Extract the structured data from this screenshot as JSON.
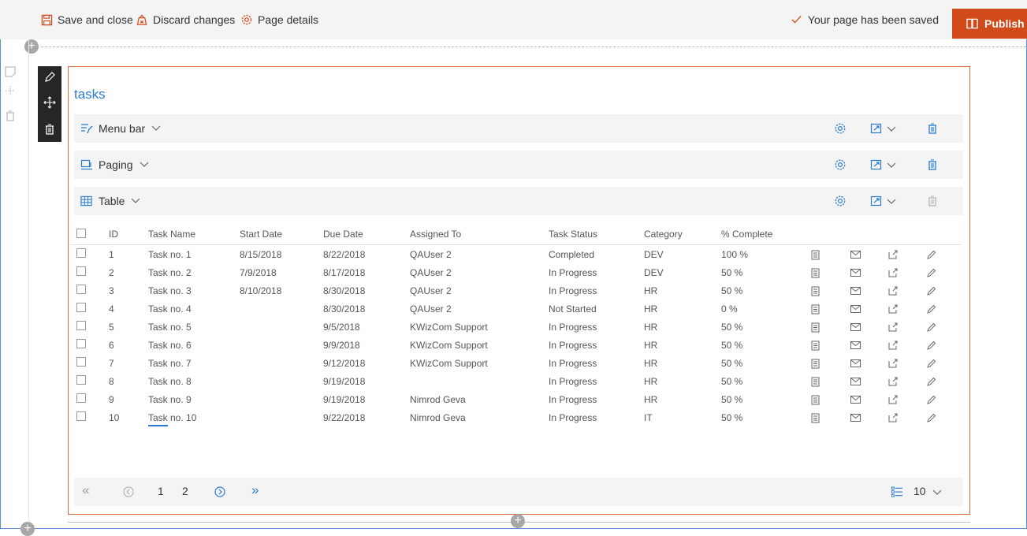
{
  "commandbar": {
    "save_close": "Save and close",
    "discard": "Discard changes",
    "details": "Page details",
    "saved_status": "Your page has been saved",
    "publish": "Publish"
  },
  "webpart": {
    "title": "tasks",
    "sections": [
      {
        "label": "Menu bar"
      },
      {
        "label": "Paging"
      },
      {
        "label": "Table"
      }
    ]
  },
  "table": {
    "headers": [
      "ID",
      "Task Name",
      "Start Date",
      "Due Date",
      "Assigned To",
      "Task Status",
      "Category",
      "% Complete"
    ],
    "rows": [
      [
        "1",
        "Task no. 1",
        "8/15/2018",
        "8/22/2018",
        "QAUser 2",
        "Completed",
        "DEV",
        "100 %"
      ],
      [
        "2",
        "Task no. 2",
        "7/9/2018",
        "8/17/2018",
        "QAUser 2",
        "In Progress",
        "DEV",
        "50 %"
      ],
      [
        "3",
        "Task no. 3",
        "8/10/2018",
        "8/30/2018",
        "QAUser 2",
        "In Progress",
        "HR",
        "50 %"
      ],
      [
        "4",
        "Task no. 4",
        "",
        "8/30/2018",
        "QAUser 2",
        "Not Started",
        "HR",
        "0 %"
      ],
      [
        "5",
        "Task no. 5",
        "",
        "9/5/2018",
        "KWizCom Support",
        "In Progress",
        "HR",
        "50 %"
      ],
      [
        "6",
        "Task no. 6",
        "",
        "9/9/2018",
        "KWizCom Support",
        "In Progress",
        "HR",
        "50 %"
      ],
      [
        "7",
        "Task no. 7",
        "",
        "9/12/2018",
        "KWizCom Support",
        "In Progress",
        "HR",
        "50 %"
      ],
      [
        "8",
        "Task no. 8",
        "",
        "9/19/2018",
        "",
        "In Progress",
        "HR",
        "50 %"
      ],
      [
        "9",
        "Task no. 9",
        "",
        "9/19/2018",
        "Nimrod Geva",
        "In Progress",
        "HR",
        "50 %"
      ],
      [
        "10",
        "Task no. 10",
        "",
        "9/22/2018",
        "Nimrod Geva",
        "In Progress",
        "IT",
        "50 %"
      ]
    ]
  },
  "pager": {
    "pages": [
      "1",
      "2"
    ],
    "current_page": "1",
    "page_size": "10"
  },
  "colors": {
    "accent": "#2a7bd0",
    "publish": "#d04a1a",
    "section_border": "#d86a3c"
  },
  "icons": {
    "save": "save-icon",
    "discard": "discard-icon",
    "details": "gear-icon",
    "saved": "checkmark-icon",
    "publish": "book-icon",
    "menu_bar": "menu-bar-icon",
    "paging": "paging-icon",
    "table": "table-grid-icon",
    "row_actions": [
      "document-icon",
      "mail-icon",
      "open-external-icon",
      "edit-pencil-icon"
    ]
  }
}
